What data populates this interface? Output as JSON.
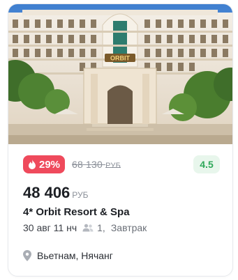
{
  "offer": {
    "discount": "29%",
    "old_price": "68 130",
    "old_price_currency": "РУБ",
    "rating": "4.5",
    "price": "48 406",
    "price_currency": "РУБ",
    "hotel_name": "4* Orbit Resort & Spa",
    "date_nights": "30 авг 11 нч",
    "guests": "1,",
    "meal": "Завтрак",
    "location": "Вьетнам, Нячанг"
  },
  "photo": {
    "sign_text": "ORBIT"
  },
  "colors": {
    "discount_bg": "#ef4a5c",
    "rating_bg": "#e8f6ec",
    "rating_text": "#2fa85a",
    "muted": "#8a8f98"
  },
  "icons": {
    "discount": "flame-icon",
    "guests": "people-icon",
    "location": "map-pin-icon"
  }
}
